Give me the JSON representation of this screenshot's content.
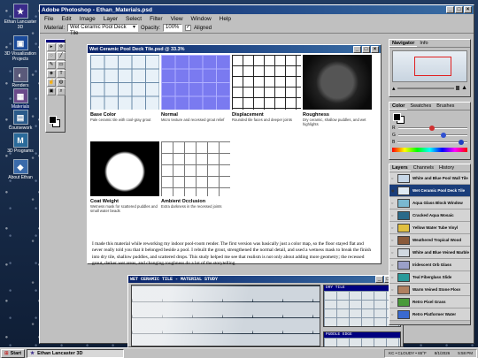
{
  "desktop": {
    "icons": [
      {
        "label": "Ethan Lancaster 3D",
        "icon": "portfolio-icon",
        "color": "#3a2a8a"
      },
      {
        "label": "3D Visualization Projects",
        "icon": "monitor-icon",
        "color": "#1a4a9a"
      },
      {
        "label": "Renders",
        "icon": "renders-icon",
        "color": "#5a5a7a"
      },
      {
        "label": "Materials",
        "icon": "materials-icon",
        "color": "#6a4a8a"
      },
      {
        "label": "Coursework",
        "icon": "coursework-icon",
        "color": "#2a5a8a"
      },
      {
        "label": "3D Programs",
        "icon": "program-icon",
        "color": "#2a6a9a"
      },
      {
        "label": "About Ethan",
        "icon": "about-icon",
        "color": "#3a6aaa"
      }
    ]
  },
  "window": {
    "title": "Adobe Photoshop - Ethan_Materials.psd",
    "menu": [
      "File",
      "Edit",
      "Image",
      "Layer",
      "Select",
      "Filter",
      "View",
      "Window",
      "Help"
    ],
    "options": {
      "material_label": "Material:",
      "material_value": "Wet Ceramic Pool Deck Tile",
      "opacity_label": "Opacity:",
      "opacity_value": "100%",
      "aligned_label": "Aligned"
    }
  },
  "toolbox": {
    "tools": [
      "▸",
      "✢",
      "◌",
      "╱",
      "✎",
      "▭",
      "◈",
      "T",
      "☝",
      "◍",
      "▣",
      "⌕"
    ]
  },
  "document": {
    "title": "Wet Ceramic Pool Deck Tile.psd @ 33.3%",
    "maps": [
      {
        "name": "Base Color",
        "desc": "Pale ceramic tile with cool-gray grout"
      },
      {
        "name": "Normal",
        "desc": "Micro texture and recessed grout relief"
      },
      {
        "name": "Displacement",
        "desc": "Rounded tile faces and deeper joints"
      },
      {
        "name": "Roughness",
        "desc": "Dry ceramic, shallow puddles, and wet highlights"
      },
      {
        "name": "Coat Weight",
        "desc": "Wetness mask for scattered puddles and small water beads"
      },
      {
        "name": "Ambient Occlusion",
        "desc": "Extra darkness in the recessed joints"
      }
    ],
    "notes": "I made this material while reworking my indoor pool-room render. The first version was basically just a color map, so the floor stayed flat and never really told you that it belonged beside a pool. I rebuilt the grout, strengthened the normal detail, and used a wetness mask to break the finish into dry tile, shallow puddles, and scattered drops. This study helped me see that realism is not only about adding more geometry; the recessed grout, darker wet areas, and changing roughness do a lot of the storytelling."
  },
  "study": {
    "title": "WET CERAMIC TILE - MATERIAL STUDY",
    "insets": [
      "DRY TILE",
      "PUDDLE EDGE"
    ]
  },
  "navigator": {
    "tabs": [
      "Navigator",
      "Info"
    ]
  },
  "color": {
    "tabs": [
      "Color",
      "Swatches",
      "Brushes"
    ],
    "sliders": [
      {
        "label": "R",
        "level": 0.45,
        "color": "#d03030"
      },
      {
        "label": "G",
        "level": 0.62,
        "color": "#3050d0"
      },
      {
        "label": "B",
        "level": 0.87,
        "color": "#2040c0"
      }
    ]
  },
  "layers": {
    "tabs": [
      "Layers",
      "Channels",
      "History"
    ],
    "items": [
      {
        "name": "White and Blue Pool Wall Tile",
        "color": "#c8d8e8",
        "selected": false
      },
      {
        "name": "Wet Ceramic Pool Deck Tile",
        "color": "#e0eaf2",
        "selected": true
      },
      {
        "name": "Aqua Glass Block Window",
        "color": "#7ab8d0",
        "selected": false
      },
      {
        "name": "Cracked Aqua Mosaic",
        "color": "#2a6a8a",
        "selected": false
      },
      {
        "name": "Yellow Water Tube Vinyl",
        "color": "#e0c040",
        "selected": false
      },
      {
        "name": "Weathered Tropical Wood",
        "color": "#8a5a3a",
        "selected": false
      },
      {
        "name": "White and Blue Veined Marble",
        "color": "#d0d8e0",
        "selected": false
      },
      {
        "name": "Iridescent Orb Glass",
        "color": "#9aa0c8",
        "selected": false
      },
      {
        "name": "Teal Fiberglass Slide",
        "color": "#2a9a9a",
        "selected": false
      },
      {
        "name": "Warm Veined Stone Floor",
        "color": "#b08060",
        "selected": false
      },
      {
        "name": "Retro Pixel Grass",
        "color": "#4a9a3a",
        "selected": false
      },
      {
        "name": "Retro Platformer Water",
        "color": "#3a6ad0",
        "selected": false
      }
    ]
  },
  "taskbar": {
    "start_label": "Start",
    "task_label": "Ethan Lancaster 3D",
    "tray_items": [
      "KC • CLOUDY • 65°F",
      "8/1/2026",
      "5:58 PM"
    ]
  }
}
